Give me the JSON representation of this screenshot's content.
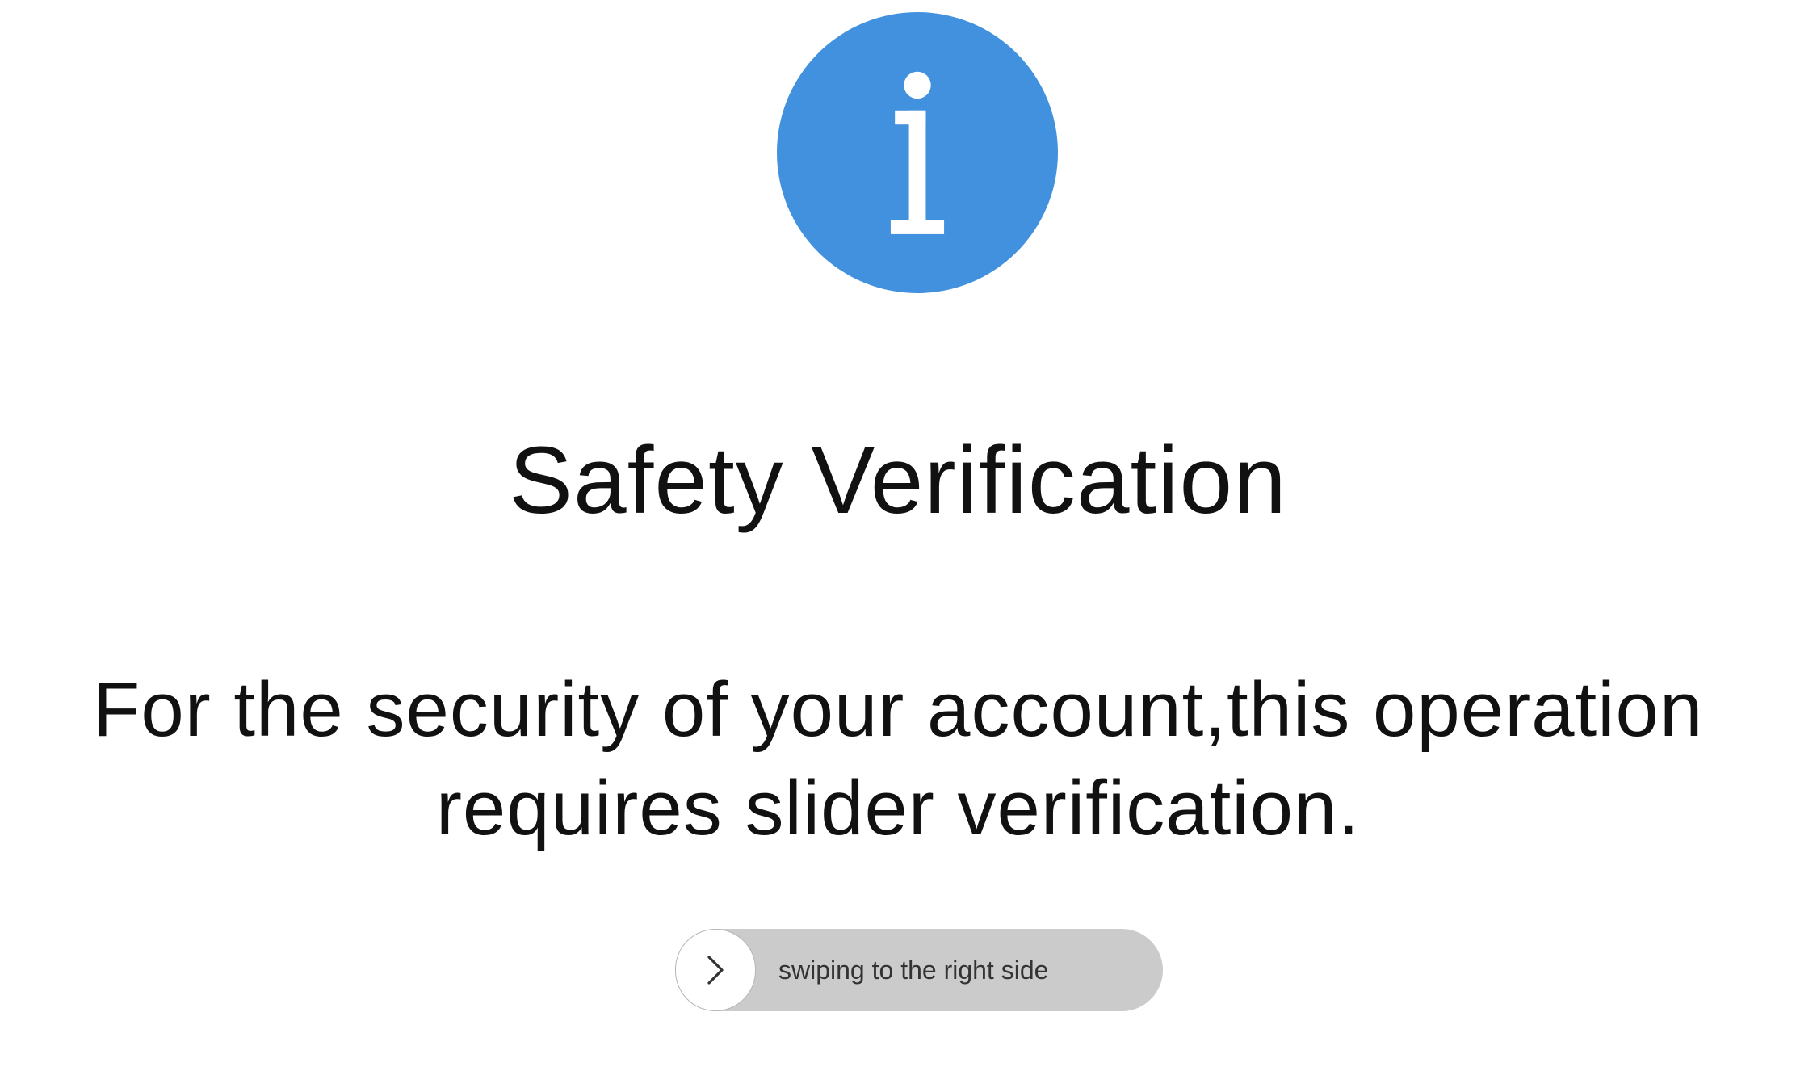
{
  "title": "Safety Verification",
  "message": "For the security of your account,this operation requires slider verification.",
  "slider": {
    "label": "swiping to the right side",
    "progress": 0
  },
  "icons": {
    "info": "info-icon",
    "handle": "chevron-right-icon"
  },
  "colors": {
    "icon_blue": "#4291de",
    "slider_track": "#cbcbcb",
    "slider_handle": "#ffffff"
  }
}
